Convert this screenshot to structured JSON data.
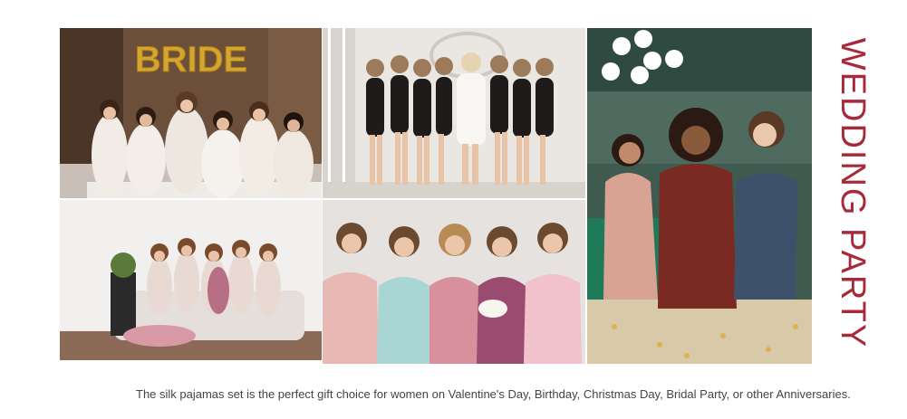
{
  "heading": "WEDDING PARTY",
  "caption": "The silk pajamas set is the perfect gift choice for women on Valentine's Day, Birthday, Christmas Day, Bridal Party, or other Anniversaries.",
  "photos": {
    "top_left": {
      "balloon_text": "BRIDE",
      "balloon_color": "#d4a52f"
    },
    "accent_red": "#a8293a"
  }
}
